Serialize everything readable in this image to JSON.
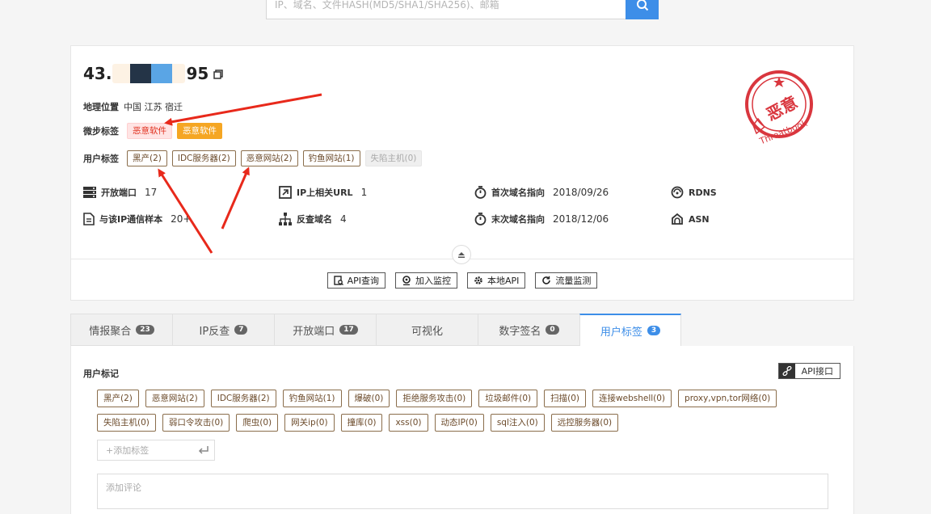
{
  "search": {
    "placeholder": "IP、域名、文件HASH(MD5/SHA1/SHA256)、邮箱"
  },
  "ip": {
    "prefix": "43.",
    "suffix": "95"
  },
  "geo": {
    "label": "地理位置",
    "value": "中国 江苏 宿迁"
  },
  "weibu_tags": {
    "label": "微步标签",
    "items": [
      "恶意软件",
      "恶意软件"
    ]
  },
  "user_tags": {
    "label": "用户标签",
    "items": [
      "黑产(2)",
      "IDC服务器(2)",
      "恶意网站(2)",
      "钓鱼网站(1)",
      "失陷主机(0)"
    ]
  },
  "stats": {
    "open_ports": {
      "label": "开放端口",
      "value": "17"
    },
    "related_url": {
      "label": "IP上相关URL",
      "value": "1"
    },
    "first_resolve": {
      "label": "首次域名指向",
      "value": "2018/09/26"
    },
    "rdns": {
      "label": "RDNS"
    },
    "samples": {
      "label": "与该IP通信样本",
      "value": "20+"
    },
    "reverse_domain": {
      "label": "反查域名",
      "value": "4"
    },
    "last_resolve": {
      "label": "末次域名指向",
      "value": "2018/12/06"
    },
    "asn": {
      "label": "ASN"
    }
  },
  "actions": [
    "API查询",
    "加入监控",
    "本地API",
    "流量监测"
  ],
  "stamp": {
    "text": "恶意",
    "brand": "Threatbook",
    "color": "#d9363e"
  },
  "tabs": [
    {
      "label": "情报聚合",
      "badge": "23"
    },
    {
      "label": "IP反查",
      "badge": "7"
    },
    {
      "label": "开放端口",
      "badge": "17"
    },
    {
      "label": "可视化",
      "badge": ""
    },
    {
      "label": "数字签名",
      "badge": "0"
    },
    {
      "label": "用户标签",
      "badge": "3",
      "active": true
    }
  ],
  "panel": {
    "title": "用户标记",
    "api_label": "API接口",
    "tags": [
      "黑产(2)",
      "恶意网站(2)",
      "IDC服务器(2)",
      "钓鱼网站(1)",
      "爆破(0)",
      "拒绝服务攻击(0)",
      "垃圾邮件(0)",
      "扫描(0)",
      "连接webshell(0)",
      "proxy,vpn,tor网络(0)",
      "失陷主机(0)",
      "弱口令攻击(0)",
      "爬虫(0)",
      "网关ip(0)",
      "撞库(0)",
      "xss(0)",
      "动态IP(0)",
      "sql注入(0)",
      "远控服务器(0)"
    ],
    "add_tag_placeholder": "+添加标签",
    "comment_placeholder": "添加评论"
  },
  "colors": {
    "accent": "#3d8ee8",
    "arrow": "#e8291b",
    "malware_red": "#e0301e",
    "malware_orange": "#f5a623"
  }
}
